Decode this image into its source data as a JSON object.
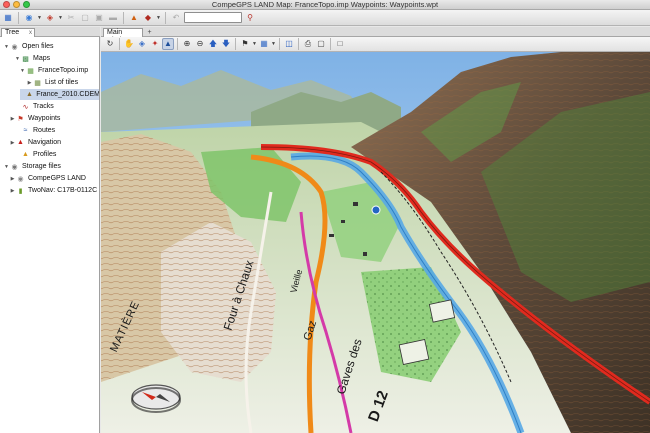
{
  "window": {
    "title": "CompeGPS LAND Map: FranceTopo.imp Waypoints: Waypoints.wpt",
    "traffic_lights": [
      "#fc605c",
      "#fdbc40",
      "#34c84a"
    ]
  },
  "toolbar": {
    "search": {
      "value": "",
      "placeholder": ""
    }
  },
  "left_panel": {
    "tab_label": "Tree",
    "tab_close": "x",
    "tree": [
      {
        "label": "Open files",
        "twisty": "▼",
        "icon": "open-files-icon"
      },
      {
        "label": "Maps",
        "twisty": "▼",
        "icon": "maps-icon"
      },
      {
        "label": "FranceTopo.imp",
        "twisty": "▼",
        "icon": "map-file-icon"
      },
      {
        "label": "List of tiles",
        "twisty": "▶",
        "icon": "tiles-icon"
      },
      {
        "label": "France_2010.CDEM",
        "twisty": "",
        "icon": "cdem-file-icon"
      },
      {
        "label": "Tracks",
        "twisty": "",
        "icon": "track-icon"
      },
      {
        "label": "Waypoints",
        "twisty": "▶",
        "icon": "waypoint-icon"
      },
      {
        "label": "Routes",
        "twisty": "",
        "icon": "route-icon"
      },
      {
        "label": "Navigation",
        "twisty": "▶",
        "icon": "navigation-icon"
      },
      {
        "label": "Profiles",
        "twisty": "",
        "icon": "profile-icon"
      },
      {
        "label": "Storage files",
        "twisty": "▼",
        "icon": "storage-icon"
      },
      {
        "label": "CompeGPS LAND",
        "twisty": "▶",
        "icon": "disk-icon"
      },
      {
        "label": "TwoNav: C17B-0112C",
        "twisty": "▶",
        "icon": "device-icon"
      }
    ]
  },
  "main": {
    "tab_label": "Main window",
    "tab_add": "+"
  },
  "map": {
    "labels": [
      "Four à Chaux",
      "Gaz",
      "Gaves des",
      "Vieille",
      "D 12",
      "MATIÈRE"
    ]
  },
  "colors": {
    "sky": "#9fc5ec",
    "river": "#58a8e6",
    "road_red": "#e02a1e",
    "road_orange": "#f08a18",
    "road_pink": "#d43aa8",
    "terrain": "#c7ba9a",
    "forest": "#6fbf5f"
  }
}
